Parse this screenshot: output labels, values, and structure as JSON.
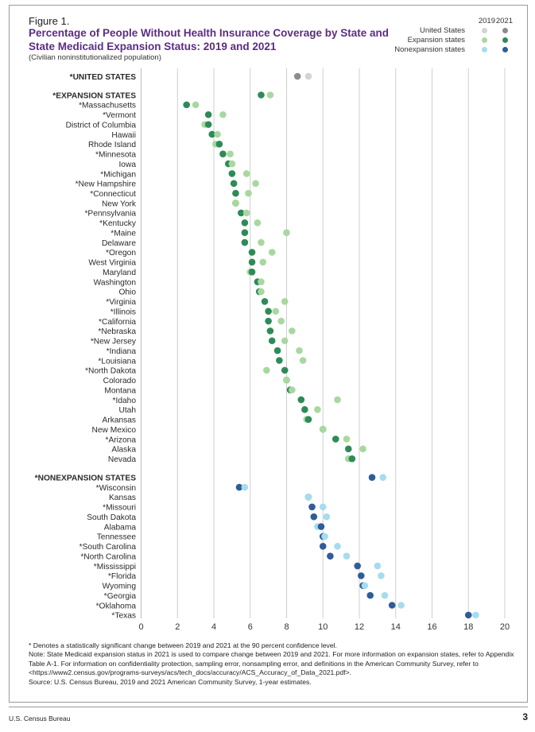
{
  "figure_label": "Figure 1.",
  "title": "Percentage of People Without Health Insurance Coverage by State and State Medicaid Expansion Status: 2019 and 2021",
  "subtitle": "(Civilian noninstitutionalized population)",
  "legend": {
    "year_headers": [
      "2019",
      "2021"
    ],
    "rows": [
      {
        "label": "United States",
        "color_2019": "#d3d3d3",
        "color_2021": "#8c8c8c"
      },
      {
        "label": "Expansion states",
        "color_2019": "#a8d8a0",
        "color_2021": "#2e8b57"
      },
      {
        "label": "Nonexpansion states",
        "color_2019": "#a6dcee",
        "color_2021": "#2f5d98"
      }
    ]
  },
  "chart_data": {
    "type": "scatter",
    "subtype": "dot-plot",
    "title": "Percentage of People Without Health Insurance Coverage by State and State Medicaid Expansion Status: 2019 and 2021",
    "xlabel": "",
    "ylabel": "",
    "xlim": [
      0,
      20
    ],
    "xticks": [
      0,
      2,
      4,
      6,
      8,
      10,
      12,
      14,
      16,
      18,
      20
    ],
    "grid": true,
    "legend_position": "top-right",
    "series": [
      {
        "name": "2019"
      },
      {
        "name": "2021"
      }
    ],
    "groups": [
      {
        "group": "us",
        "rows": [
          {
            "label": "*UNITED STATES",
            "header": true,
            "v2019": 9.2,
            "v2021": 8.6
          }
        ]
      },
      {
        "group": "expansion",
        "rows": [
          {
            "label": "*EXPANSION STATES",
            "header": true,
            "v2019": 7.1,
            "v2021": 6.6
          },
          {
            "label": "*Massachusetts",
            "v2019": 3.0,
            "v2021": 2.5
          },
          {
            "label": "*Vermont",
            "v2019": 4.5,
            "v2021": 3.7
          },
          {
            "label": "District of Columbia",
            "v2019": 3.5,
            "v2021": 3.7
          },
          {
            "label": "Hawaii",
            "v2019": 4.2,
            "v2021": 3.9
          },
          {
            "label": "Rhode Island",
            "v2019": 4.1,
            "v2021": 4.3
          },
          {
            "label": "*Minnesota",
            "v2019": 4.9,
            "v2021": 4.5
          },
          {
            "label": "Iowa",
            "v2019": 5.0,
            "v2021": 4.8
          },
          {
            "label": "*Michigan",
            "v2019": 5.8,
            "v2021": 5.0
          },
          {
            "label": "*New Hampshire",
            "v2019": 6.3,
            "v2021": 5.1
          },
          {
            "label": "*Connecticut",
            "v2019": 5.9,
            "v2021": 5.2
          },
          {
            "label": "New York",
            "v2019": 5.2,
            "v2021": 5.2
          },
          {
            "label": "*Pennsylvania",
            "v2019": 5.8,
            "v2021": 5.5
          },
          {
            "label": "*Kentucky",
            "v2019": 6.4,
            "v2021": 5.7
          },
          {
            "label": "*Maine",
            "v2019": 8.0,
            "v2021": 5.7
          },
          {
            "label": "Delaware",
            "v2019": 6.6,
            "v2021": 5.7
          },
          {
            "label": "*Oregon",
            "v2019": 7.2,
            "v2021": 6.1
          },
          {
            "label": "West Virginia",
            "v2019": 6.7,
            "v2021": 6.1
          },
          {
            "label": "Maryland",
            "v2019": 6.0,
            "v2021": 6.1
          },
          {
            "label": "Washington",
            "v2019": 6.6,
            "v2021": 6.4
          },
          {
            "label": "Ohio",
            "v2019": 6.6,
            "v2021": 6.5
          },
          {
            "label": "*Virginia",
            "v2019": 7.9,
            "v2021": 6.8
          },
          {
            "label": "*Illinois",
            "v2019": 7.4,
            "v2021": 7.0
          },
          {
            "label": "*California",
            "v2019": 7.7,
            "v2021": 7.0
          },
          {
            "label": "*Nebraska",
            "v2019": 8.3,
            "v2021": 7.1
          },
          {
            "label": "*New Jersey",
            "v2019": 7.9,
            "v2021": 7.2
          },
          {
            "label": "*Indiana",
            "v2019": 8.7,
            "v2021": 7.5
          },
          {
            "label": "*Louisiana",
            "v2019": 8.9,
            "v2021": 7.6
          },
          {
            "label": "*North Dakota",
            "v2019": 6.9,
            "v2021": 7.9
          },
          {
            "label": "Colorado",
            "v2019": 8.0,
            "v2021": 8.0
          },
          {
            "label": "Montana",
            "v2019": 8.3,
            "v2021": 8.2
          },
          {
            "label": "*Idaho",
            "v2019": 10.8,
            "v2021": 8.8
          },
          {
            "label": "Utah",
            "v2019": 9.7,
            "v2021": 9.0
          },
          {
            "label": "Arkansas",
            "v2019": 9.1,
            "v2021": 9.2
          },
          {
            "label": "New Mexico",
            "v2019": 10.0,
            "v2021": 10.0
          },
          {
            "label": "*Arizona",
            "v2019": 11.3,
            "v2021": 10.7
          },
          {
            "label": "Alaska",
            "v2019": 12.2,
            "v2021": 11.4
          },
          {
            "label": "Nevada",
            "v2019": 11.4,
            "v2021": 11.6
          }
        ]
      },
      {
        "group": "nonexpansion",
        "rows": [
          {
            "label": "*NONEXPANSION STATES",
            "header": true,
            "v2019": 13.3,
            "v2021": 12.7
          },
          {
            "label": "*Wisconsin",
            "v2019": 5.7,
            "v2021": 5.4
          },
          {
            "label": "Kansas",
            "v2019": 9.2,
            "v2021": 9.2
          },
          {
            "label": "*Missouri",
            "v2019": 10.0,
            "v2021": 9.4
          },
          {
            "label": "South Dakota",
            "v2019": 10.2,
            "v2021": 9.5
          },
          {
            "label": "Alabama",
            "v2019": 9.7,
            "v2021": 9.9
          },
          {
            "label": "Tennessee",
            "v2019": 10.1,
            "v2021": 10.0
          },
          {
            "label": "*South Carolina",
            "v2019": 10.8,
            "v2021": 10.0
          },
          {
            "label": "*North Carolina",
            "v2019": 11.3,
            "v2021": 10.4
          },
          {
            "label": "*Mississippi",
            "v2019": 13.0,
            "v2021": 11.9
          },
          {
            "label": "*Florida",
            "v2019": 13.2,
            "v2021": 12.1
          },
          {
            "label": "Wyoming",
            "v2019": 12.3,
            "v2021": 12.2
          },
          {
            "label": "*Georgia",
            "v2019": 13.4,
            "v2021": 12.6
          },
          {
            "label": "*Oklahoma",
            "v2019": 14.3,
            "v2021": 13.8
          },
          {
            "label": "*Texas",
            "v2019": 18.4,
            "v2021": 18.0
          }
        ]
      }
    ]
  },
  "notes": {
    "significance": "* Denotes a statistically significant change between 2019 and 2021 at the 90 percent confidence level.",
    "note": "Note: State Medicaid expansion status in 2021 is used to compare change between 2019 and 2021. For more information on expansion states, refer to Appendix Table A-1. For information on confidentiality protection, sampling error, nonsampling error, and definitions in the American Community Survey, refer to <https://www2.census.gov/programs-surveys/acs/tech_docs/accuracy/ACS_Accuracy_of_Data_2021.pdf>.",
    "source": "Source: U.S. Census Bureau, 2019 and 2021 American Community Survey, 1-year estimates."
  },
  "footer": {
    "publisher": "U.S. Census Bureau",
    "page_number": "3"
  }
}
